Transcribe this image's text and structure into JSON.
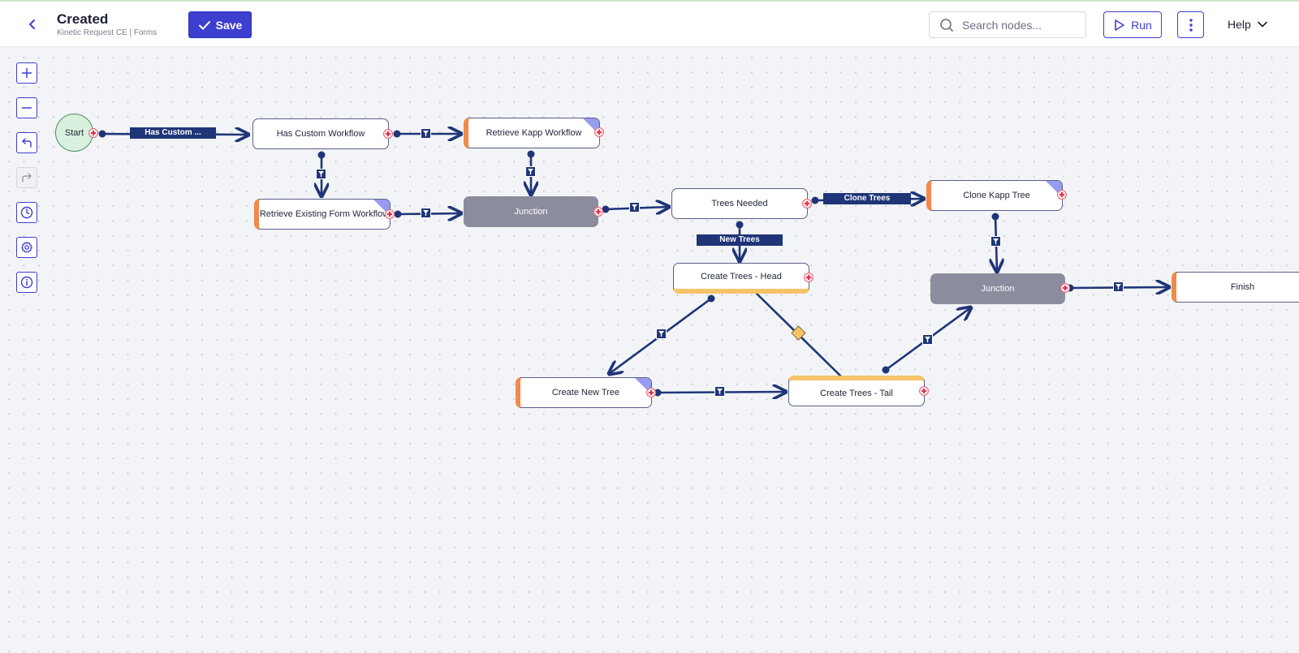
{
  "header": {
    "title": "Created",
    "subtitle": "Kinetic Request CE | Forms",
    "save_label": "Save",
    "search_placeholder": "Search nodes...",
    "run_label": "Run",
    "help_label": "Help"
  },
  "toolbar": [
    "zoom-in",
    "zoom-out",
    "undo",
    "redo",
    "history",
    "settings",
    "info"
  ],
  "nodes": {
    "start": "Start",
    "has_custom_workflow": "Has Custom Workflow",
    "retrieve_kapp_workflow": "Retrieve Kapp Workflow",
    "retrieve_existing_form_workflow": "Retrieve Existing Form Workflow",
    "junction1": "Junction",
    "trees_needed": "Trees Needed",
    "clone_kapp_tree": "Clone Kapp Tree",
    "create_trees_head": "Create Trees - Head",
    "junction2": "Junction",
    "finish": "Finish",
    "create_new_tree": "Create New Tree",
    "create_trees_tail": "Create Trees - Tail"
  },
  "edge_labels": {
    "has_custom": "Has Custom ...",
    "clone_trees": "Clone Trees",
    "new_trees": "New Trees"
  },
  "colors": {
    "accent": "#3d3fcf",
    "edge": "#1f3578",
    "task_marker": "#f08a4b",
    "loop_marker": "#f5c468",
    "junction": "#8b8c9d",
    "start": "#d8f1de"
  }
}
